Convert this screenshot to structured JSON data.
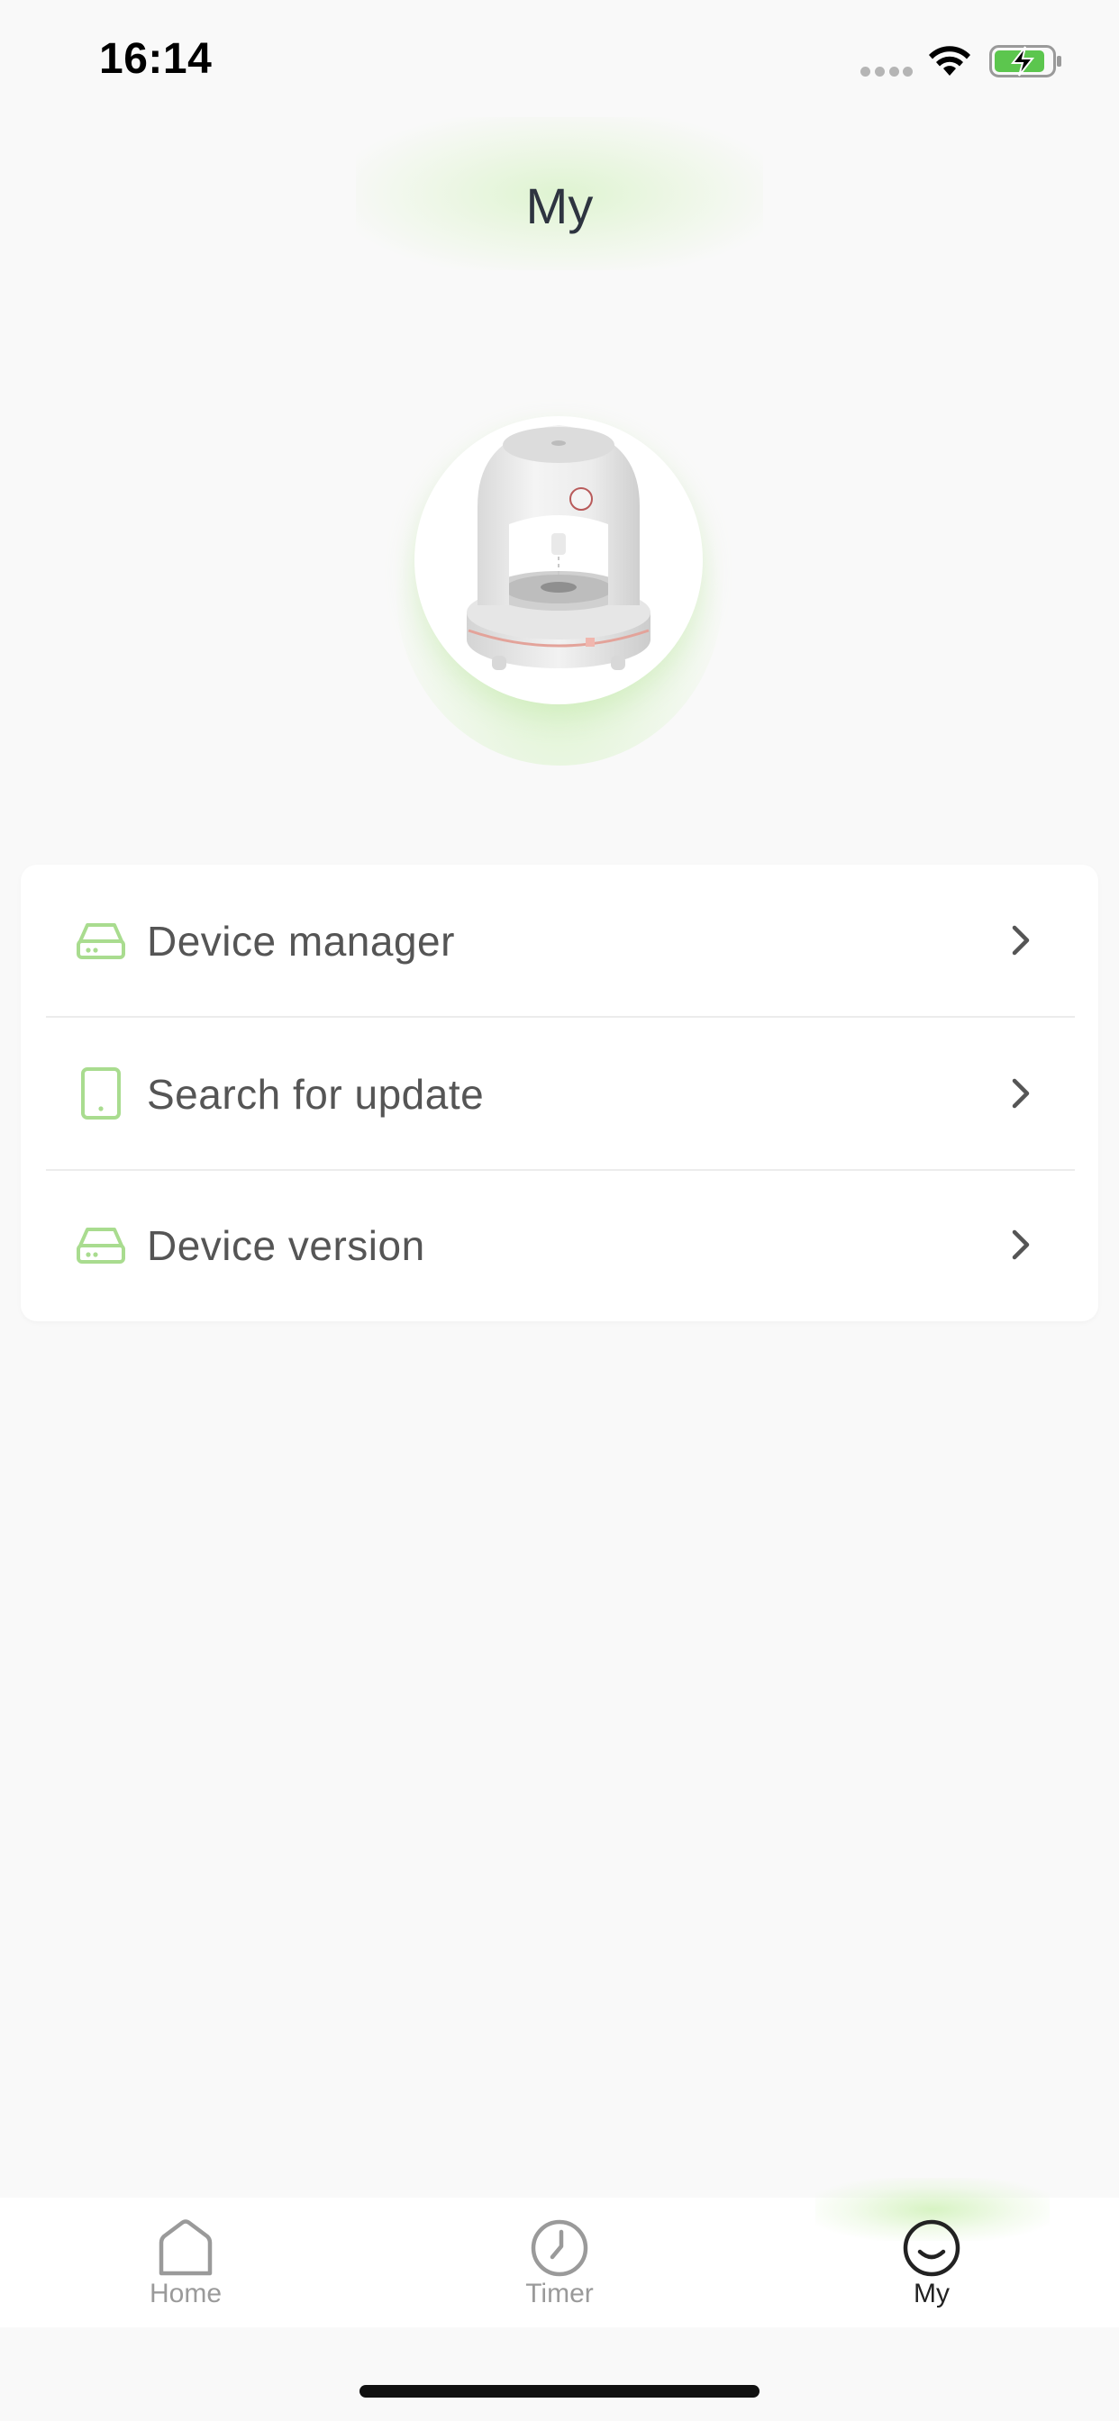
{
  "status_bar": {
    "time": "16:14"
  },
  "header": {
    "title": "My"
  },
  "device": {
    "image_icon": "humidifier-device-image"
  },
  "menu": {
    "items": [
      {
        "label": "Device manager",
        "icon": "drive-icon"
      },
      {
        "label": "Search for update",
        "icon": "tablet-icon"
      },
      {
        "label": "Device version",
        "icon": "drive-icon"
      }
    ]
  },
  "tab_bar": {
    "tabs": [
      {
        "label": "Home",
        "icon": "home-icon",
        "active": false
      },
      {
        "label": "Timer",
        "icon": "clock-icon",
        "active": false
      },
      {
        "label": "My",
        "icon": "smile-icon",
        "active": true
      }
    ]
  },
  "colors": {
    "background": "#f9f9f9",
    "accent_green": "#a9dc8f",
    "battery_green": "#5cc64e",
    "text_primary": "#555555",
    "tab_inactive": "#9a9a9a"
  }
}
